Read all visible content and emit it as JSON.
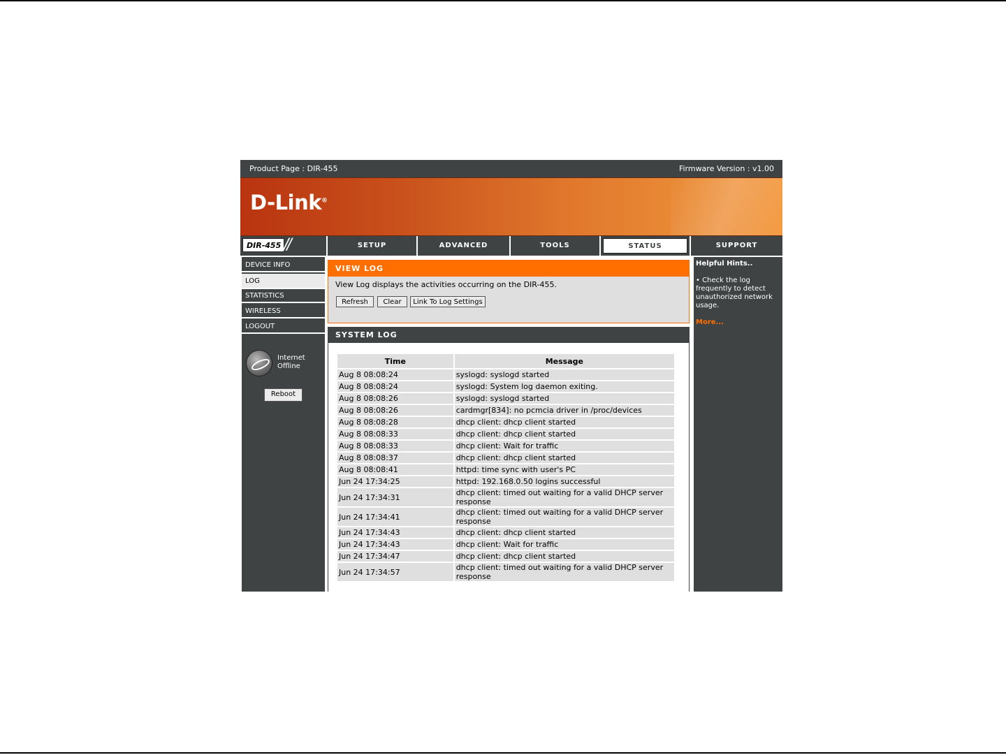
{
  "topbar": {
    "product": "Product Page :  DIR-455",
    "firmware": "Firmware Version : v1.00"
  },
  "brand": {
    "logo": "D-Link",
    "model": "DIR-455"
  },
  "tabs": [
    {
      "label": "SETUP"
    },
    {
      "label": "ADVANCED"
    },
    {
      "label": "TOOLS"
    },
    {
      "label": "STATUS"
    },
    {
      "label": "SUPPORT"
    }
  ],
  "sidebar": {
    "items": [
      {
        "label": "DEVICE INFO"
      },
      {
        "label": "LOG"
      },
      {
        "label": "STATISTICS"
      },
      {
        "label": "WIRELESS"
      },
      {
        "label": "LOGOUT"
      }
    ],
    "internet_line1": "Internet",
    "internet_line2": "Offline",
    "reboot": "Reboot"
  },
  "view_log": {
    "title": "VIEW LOG",
    "description": "View Log displays the activities occurring on the DIR-455.",
    "refresh": "Refresh",
    "clear": "Clear",
    "link_settings": "Link To Log Settings"
  },
  "system_log": {
    "title": "SYSTEM LOG",
    "col_time": "Time",
    "col_message": "Message",
    "rows": [
      {
        "time": "Aug 8 08:08:24",
        "message": "syslogd: syslogd started"
      },
      {
        "time": "Aug 8 08:08:24",
        "message": "syslogd: System log daemon exiting."
      },
      {
        "time": "Aug 8 08:08:26",
        "message": "syslogd: syslogd started"
      },
      {
        "time": "Aug 8 08:08:26",
        "message": "cardmgr[834]: no pcmcia driver in /proc/devices"
      },
      {
        "time": "Aug 8 08:08:28",
        "message": "dhcp client: dhcp client started"
      },
      {
        "time": "Aug 8 08:08:33",
        "message": "dhcp client: dhcp client started"
      },
      {
        "time": "Aug 8 08:08:33",
        "message": "dhcp client: Wait for traffic"
      },
      {
        "time": "Aug 8 08:08:37",
        "message": "dhcp client: dhcp client started"
      },
      {
        "time": "Aug 8 08:08:41",
        "message": "httpd: time sync with user's PC"
      },
      {
        "time": "Jun 24 17:34:25",
        "message": "httpd: 192.168.0.50 logins successful"
      },
      {
        "time": "Jun 24 17:34:31",
        "message": "dhcp client: timed out waiting for a valid DHCP server response"
      },
      {
        "time": "Jun 24 17:34:41",
        "message": "dhcp client: timed out waiting for a valid DHCP server response"
      },
      {
        "time": "Jun 24 17:34:43",
        "message": "dhcp client: dhcp client started"
      },
      {
        "time": "Jun 24 17:34:43",
        "message": "dhcp client: Wait for traffic"
      },
      {
        "time": "Jun 24 17:34:47",
        "message": "dhcp client: dhcp client started"
      },
      {
        "time": "Jun 24 17:34:57",
        "message": "dhcp client: timed out waiting for a valid DHCP server response"
      }
    ]
  },
  "hints": {
    "title": "Helpful Hints..",
    "body": "• Check the log frequently to detect unauthorized network usage.",
    "more": "More..."
  },
  "colors": {
    "accent": "#ff6f00",
    "dark": "#404343",
    "panel": "#dfdfdf"
  }
}
